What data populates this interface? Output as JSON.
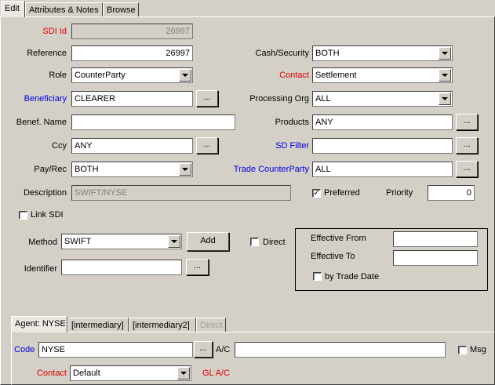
{
  "tabs": {
    "edit": "Edit",
    "attributes": "Attributes & Notes",
    "browse": "Browse"
  },
  "labels": {
    "sdi_id": "SDI Id",
    "reference": "Reference",
    "role": "Role",
    "beneficiary": "Beneficiary",
    "benef_name": "Benef. Name",
    "ccy": "Ccy",
    "pay_rec": "Pay/Rec",
    "description": "Description",
    "cash_security": "Cash/Security",
    "contact": "Contact",
    "processing_org": "Processing Org",
    "products": "Products",
    "sd_filter": "SD Filter",
    "trade_counterparty": "Trade CounterParty",
    "preferred": "Preferred",
    "priority": "Priority",
    "link_sdi": "Link SDI",
    "method": "Method",
    "identifier": "Identifier",
    "direct": "Direct",
    "effective_from": "Effective From",
    "effective_to": "Effective To",
    "by_trade_date": "by Trade Date"
  },
  "values": {
    "sdi_id": "26997",
    "reference": "26997",
    "role": "CounterParty",
    "beneficiary": "CLEARER",
    "benef_name": "",
    "ccy": "ANY",
    "pay_rec": "BOTH",
    "description": "SWIFT/NYSE",
    "cash_security": "BOTH",
    "contact": "Settlement",
    "processing_org": "ALL",
    "products": "ANY",
    "sd_filter": "",
    "trade_counterparty": "ALL",
    "priority": "0",
    "method": "SWIFT",
    "identifier": "",
    "effective_from": "",
    "effective_to": ""
  },
  "checks": {
    "preferred": true,
    "link_sdi": false,
    "direct": false,
    "by_trade_date": false
  },
  "buttons": {
    "ellipsis": "...",
    "add": "Add"
  },
  "agent_tabs": {
    "agent": "Agent: NYSE",
    "intermediary": "[intermediary]",
    "intermediary2": "[intermediary2]",
    "direct": "Direct"
  },
  "agent": {
    "code_label": "Code",
    "code_value": "NYSE",
    "ac_label": "A/C",
    "ac_value": "",
    "msg_label": "Msg",
    "contact_label": "Contact",
    "contact_value": "Default",
    "gl_ac_label": "GL A/C"
  },
  "checks_agent": {
    "msg": false
  }
}
